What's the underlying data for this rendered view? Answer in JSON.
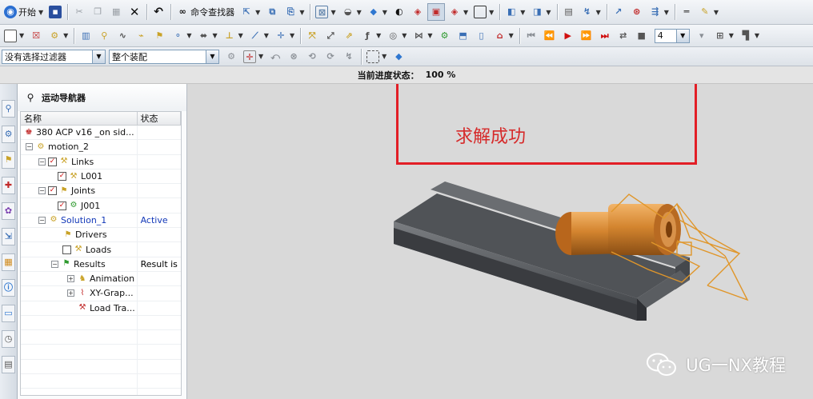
{
  "toolbar": {
    "start_label": "开始",
    "command_finder_label": "命令查找器",
    "animation_speed": "4"
  },
  "filters": {
    "selection_filter": "没有选择过滤器",
    "assembly_scope": "整个装配"
  },
  "status": {
    "progress_label": "当前进度状态：",
    "progress_value": "100 %"
  },
  "navigator": {
    "title": "运动导航器",
    "columns": {
      "name": "名称",
      "state": "状态"
    },
    "rows": [
      {
        "name": "380 ACP v16 _on sid...",
        "state": "",
        "icon": "assembly-icon"
      },
      {
        "name": "motion_2",
        "state": "",
        "icon": "motion-icon"
      },
      {
        "name": "Links",
        "state": "",
        "icon": "links-icon"
      },
      {
        "name": "L001",
        "state": "",
        "icon": "link-icon"
      },
      {
        "name": "Joints",
        "state": "",
        "icon": "joints-icon"
      },
      {
        "name": "J001",
        "state": "",
        "icon": "joint-icon"
      },
      {
        "name": "Solution_1",
        "state": "Active",
        "icon": "solution-icon"
      },
      {
        "name": "Drivers",
        "state": "",
        "icon": "drivers-icon"
      },
      {
        "name": "Loads",
        "state": "",
        "icon": "loads-icon"
      },
      {
        "name": "Results",
        "state": "Result is",
        "icon": "results-icon"
      },
      {
        "name": "Animation",
        "state": "",
        "icon": "animation-icon"
      },
      {
        "name": "XY-Grap...",
        "state": "",
        "icon": "xy-graph-icon"
      },
      {
        "name": "Load Tra...",
        "state": "",
        "icon": "load-transfer-icon"
      }
    ]
  },
  "viewport": {
    "annotation_text": "求解成功",
    "watermark_text": "UG一NX教程"
  },
  "colors": {
    "annotation_red": "#e21e26",
    "active_blue": "#1238b8",
    "part_copper": "#c7782a",
    "channel_gray": "#5c5f63"
  }
}
